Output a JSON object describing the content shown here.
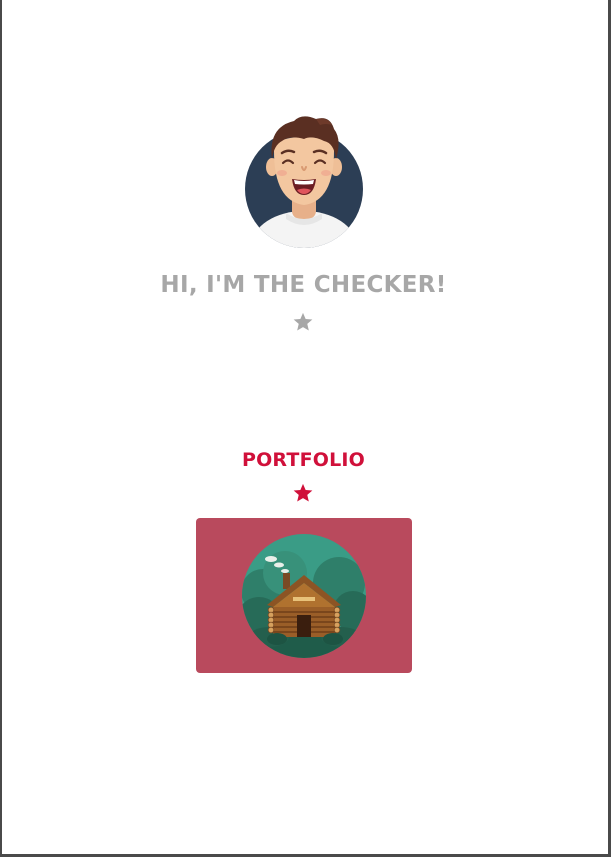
{
  "masthead": {
    "greeting": "HI, I'M THE CHECKER!",
    "avatar_icon": "smiling-man-avatar",
    "divider_icon": "star-icon"
  },
  "portfolio": {
    "title": "PORTFOLIO",
    "divider_icon": "star-icon",
    "items": [
      {
        "image_icon": "log-cabin-illustration",
        "background": "#b94a5d"
      }
    ]
  },
  "colors": {
    "greeting_text": "#a7a7a7",
    "section_title_text": "#d0103a",
    "gray_star": "#a7a7a7",
    "red_star": "#d0103a",
    "card_background": "#b94a5d"
  }
}
